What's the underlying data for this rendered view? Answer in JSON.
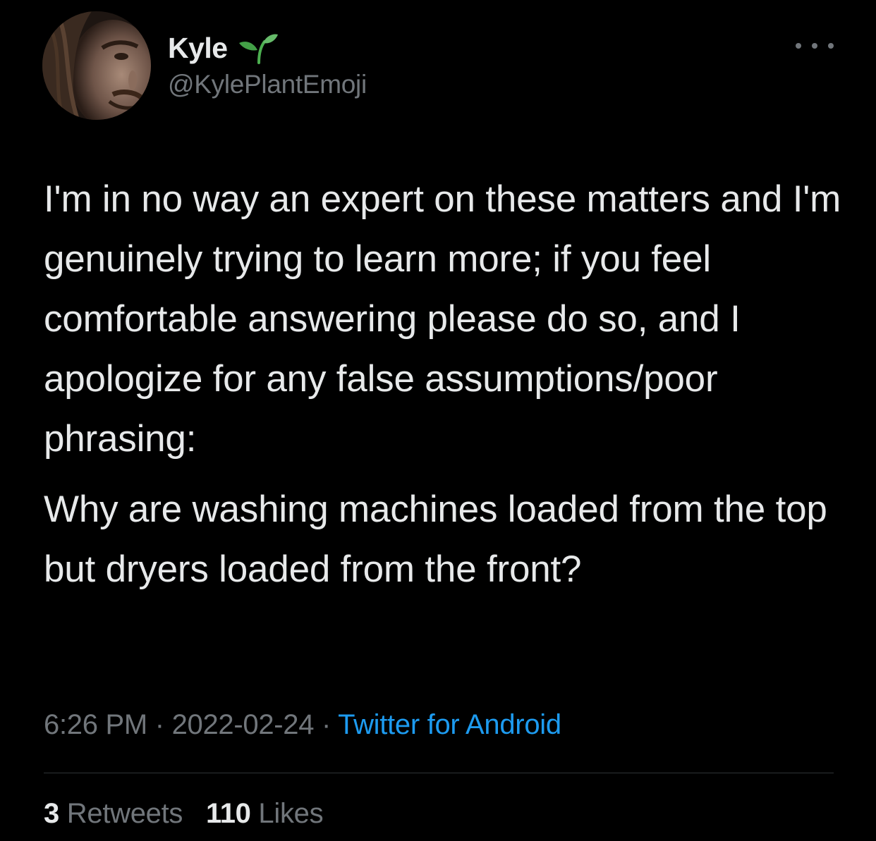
{
  "author": {
    "display_name": "Kyle",
    "display_name_emoji": "seedling-icon",
    "handle": "@KylePlantEmoji"
  },
  "tweet": {
    "paragraphs": [
      "I'm in no way an expert on these matters and I'm genuinely trying to learn more; if you feel comfortable answering please do so, and I apologize for any false assumptions/poor phrasing:",
      "Why are washing machines loaded from the top but dryers loaded from the front?"
    ],
    "time": "6:26 PM",
    "separator": "·",
    "date": "2022-02-24",
    "source": "Twitter for Android"
  },
  "stats": {
    "retweets_count": "3",
    "retweets_label": "Retweets",
    "likes_count": "110",
    "likes_label": "Likes"
  },
  "colors": {
    "background": "#000000",
    "text": "#e7e9ea",
    "secondary": "#71767b",
    "link": "#1d9bf0",
    "divider": "#2f3336"
  }
}
